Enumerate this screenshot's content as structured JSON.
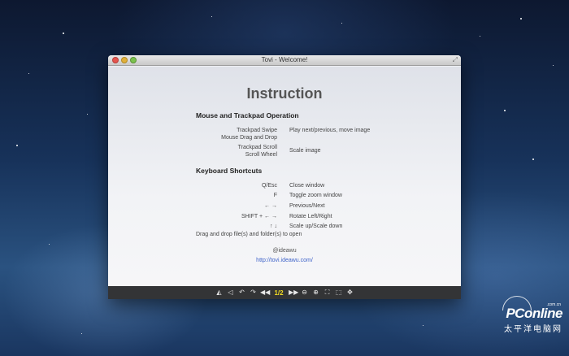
{
  "window": {
    "title": "Tovi - Welcome!"
  },
  "content": {
    "heading": "Instruction",
    "mouse_section": {
      "title": "Mouse and Trackpad Operation",
      "rows": [
        {
          "label": "Trackpad Swipe\nMouse Drag and Drop",
          "desc": "Play next/previous, move image"
        },
        {
          "label": "Trackpad Scroll\nScroll Wheel",
          "desc": "Scale image"
        }
      ]
    },
    "keyboard_section": {
      "title": "Keyboard Shortcuts",
      "rows": [
        {
          "label": "Q/Esc",
          "desc": "Close window"
        },
        {
          "label": "F",
          "desc": "Toggle zoom window"
        },
        {
          "label": "← →",
          "desc": "Previous/Next"
        },
        {
          "label": "SHIFT + ← →",
          "desc": "Rotate Left/Right"
        },
        {
          "label": "↑ ↓",
          "desc": "Scale up/Scale down"
        }
      ]
    },
    "drag_note": "Drag and drop file(s) and folder(s) to open",
    "credit": "@ideawu",
    "link": "http://tovi.ideawu.com/"
  },
  "toolbar": {
    "page_indicator": "1/2",
    "icons": [
      "flip-horizontal-icon",
      "flip-vertical-icon",
      "rotate-left-icon",
      "rotate-right-icon",
      "previous-icon",
      "next-icon",
      "zoom-out-icon",
      "zoom-in-icon",
      "fit-window-icon",
      "actual-size-icon",
      "fullscreen-icon"
    ]
  },
  "watermark": {
    "brand": "PConline",
    "domain": ".com.cn",
    "chinese": "太平洋电脑网"
  }
}
